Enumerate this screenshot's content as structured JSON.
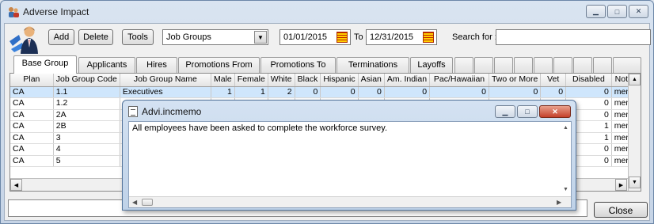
{
  "window": {
    "title": "Adverse Impact"
  },
  "toolbar": {
    "add_label": "Add",
    "delete_label": "Delete",
    "tools_label": "Tools",
    "view_select": "Job Groups",
    "date_from": "01/01/2015",
    "to_label": "To",
    "date_to": "12/31/2015",
    "search_label": "Search for :",
    "search_value": ""
  },
  "tabs": [
    {
      "label": "Base Group",
      "active": true
    },
    {
      "label": "Applicants"
    },
    {
      "label": "Hires"
    },
    {
      "label": "Promotions From"
    },
    {
      "label": "Promotions To"
    },
    {
      "label": "Terminations"
    },
    {
      "label": "Layoffs"
    }
  ],
  "grid": {
    "columns": [
      "Plan",
      "Job Group Code",
      "Job Group Name",
      "Male",
      "Female",
      "White",
      "Black",
      "Hispanic",
      "Asian",
      "Am. Indian",
      "Pac/Hawaiian",
      "Two or More",
      "Vet",
      "Disabled",
      "Notes"
    ],
    "rows": [
      [
        "CA",
        "1.1",
        "Executives",
        "1",
        "1",
        "2",
        "0",
        "0",
        "0",
        "0",
        "0",
        "0",
        "0",
        "0",
        "memo"
      ],
      [
        "CA",
        "1.2",
        "",
        "",
        "",
        "",
        "",
        "",
        "",
        "",
        "",
        "",
        "",
        "0",
        "memo"
      ],
      [
        "CA",
        "2A",
        "",
        "",
        "",
        "",
        "",
        "",
        "",
        "",
        "",
        "",
        "",
        "0",
        "memo"
      ],
      [
        "CA",
        "2B",
        "",
        "",
        "",
        "",
        "",
        "",
        "",
        "",
        "",
        "",
        "",
        "1",
        "memo"
      ],
      [
        "CA",
        "3",
        "",
        "",
        "",
        "",
        "",
        "",
        "",
        "",
        "",
        "",
        "",
        "1",
        "memo"
      ],
      [
        "CA",
        "4",
        "",
        "",
        "",
        "",
        "",
        "",
        "",
        "",
        "",
        "",
        "",
        "0",
        "memo"
      ],
      [
        "CA",
        "5",
        "",
        "",
        "",
        "",
        "",
        "",
        "",
        "",
        "",
        "",
        "",
        "0",
        "memo"
      ]
    ]
  },
  "footer": {
    "close_label": "Close"
  },
  "memo": {
    "title": "Advi.incmemo",
    "text": "All employees have been asked to complete the workforce survey."
  },
  "colors": {
    "selected_row": "#cfe6fc",
    "memo_close": "#c4402a"
  }
}
